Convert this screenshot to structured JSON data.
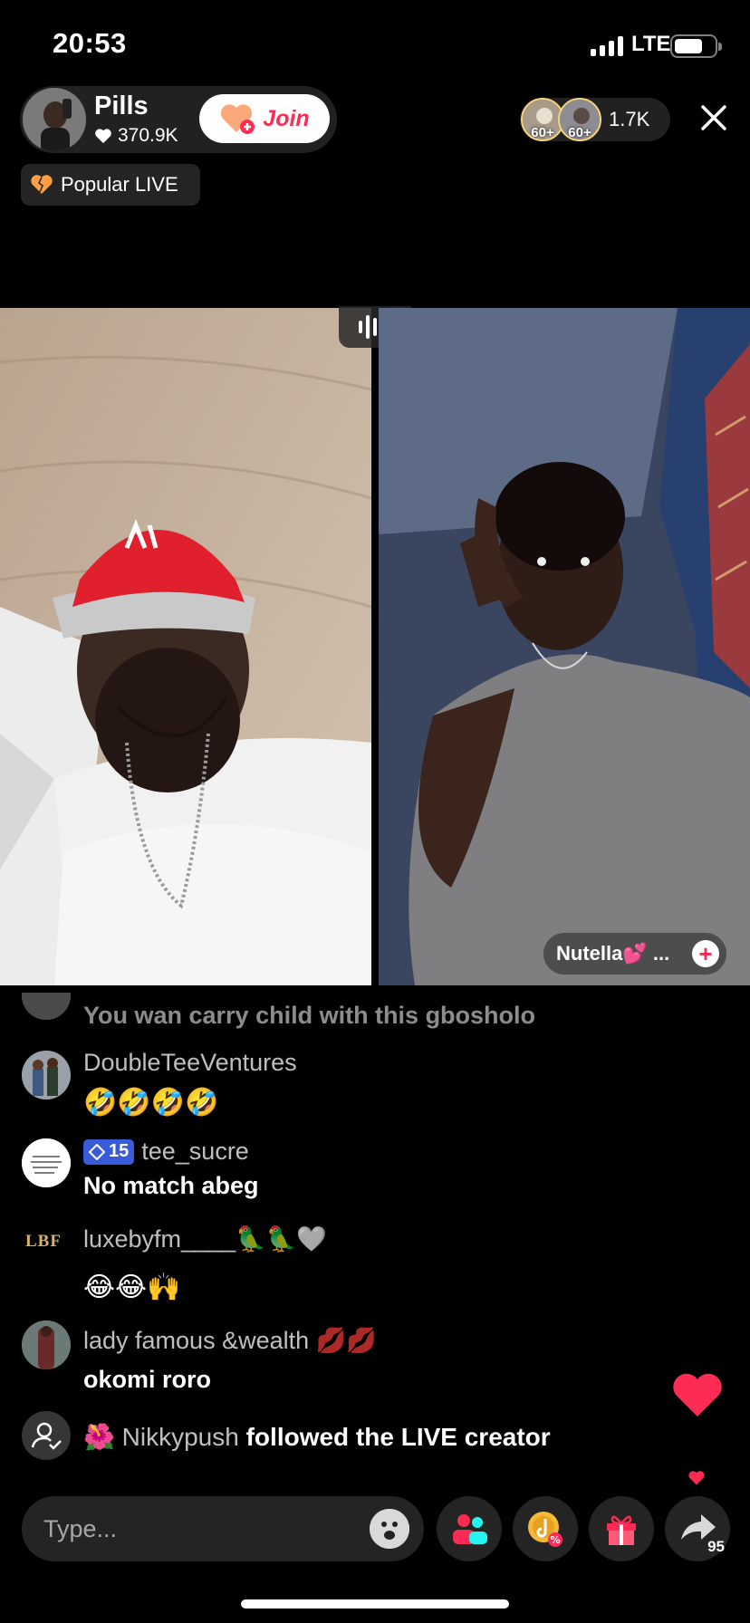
{
  "status_bar": {
    "time": "20:53",
    "network": "LTE"
  },
  "host": {
    "name": "Pills",
    "likes": "370.9K",
    "join_label": "Join"
  },
  "popular_label": "Popular LIVE",
  "viewers": {
    "avatar_badges": [
      "60+",
      "60+"
    ],
    "count": "1.7K"
  },
  "guest_tag": {
    "label": "Nutella💕 ..."
  },
  "comments": [
    {
      "user": "",
      "text": "You wan carry child with this gbosholo"
    },
    {
      "user": "DoubleTeeVentures",
      "text": "🤣🤣🤣🤣"
    },
    {
      "user": "tee_sucre",
      "level": "15",
      "text": "No match abeg"
    },
    {
      "user": "luxebyfm____🦜🦜🤍",
      "avatar_text": "LBF",
      "text": "😂😂🙌"
    },
    {
      "user": "lady famous &wealth 💋💋",
      "text": "okomi roro"
    }
  ],
  "follow_notice": {
    "emoji": "🌺",
    "user": "Nikkypush",
    "text": "followed the LIVE creator"
  },
  "bottom_bar": {
    "input_placeholder": "Type...",
    "share_count": "95"
  },
  "colors": {
    "accent": "#fe2c55",
    "background": "#000000"
  }
}
